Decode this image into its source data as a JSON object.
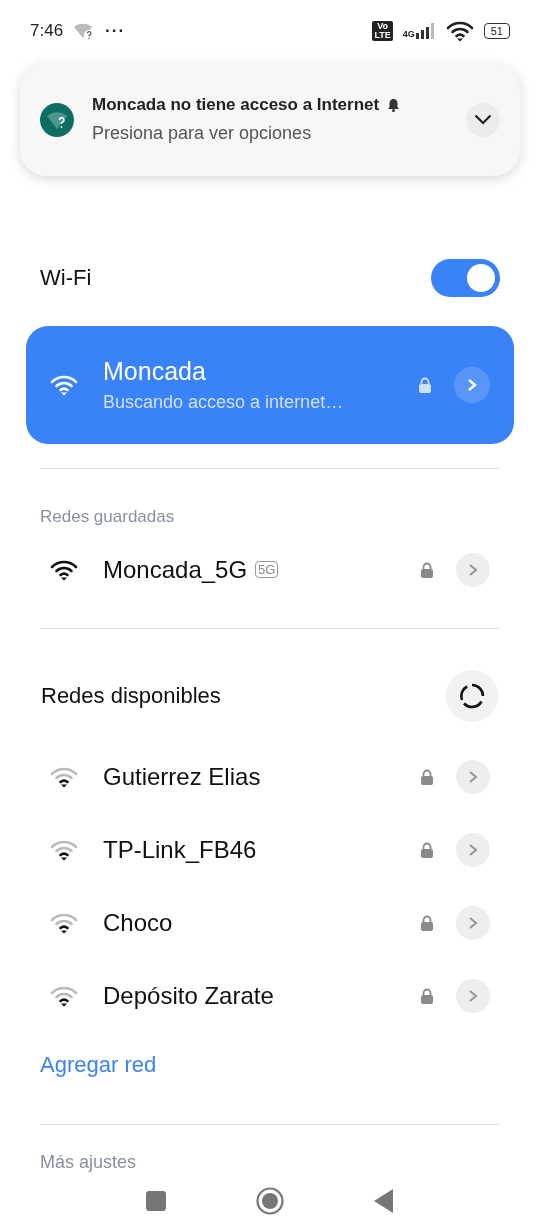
{
  "status_bar": {
    "time": "7:46",
    "overflow": "···",
    "volte": [
      "Vo",
      "LTE"
    ],
    "network_type": "4G",
    "battery": "51"
  },
  "notification": {
    "title": "Moncada no tiene acceso a Internet",
    "subtitle": "Presiona para ver opciones"
  },
  "wifi_toggle": {
    "label": "Wi-Fi",
    "on": true
  },
  "connected_network": {
    "name": "Moncada",
    "status": "Buscando acceso a internet…",
    "secured": true
  },
  "saved_networks": {
    "heading": "Redes guardadas",
    "items": [
      {
        "name": "Moncada_5G",
        "badge": "5G",
        "secured": true
      }
    ]
  },
  "available_networks": {
    "heading": "Redes disponibles",
    "items": [
      {
        "name": "Gutierrez Elias",
        "secured": true
      },
      {
        "name": "TP-Link_FB46",
        "secured": true
      },
      {
        "name": "Choco",
        "secured": true
      },
      {
        "name": "Depósito Zarate",
        "secured": true
      }
    ]
  },
  "add_network": "Agregar red",
  "more_settings": "Más ajustes"
}
